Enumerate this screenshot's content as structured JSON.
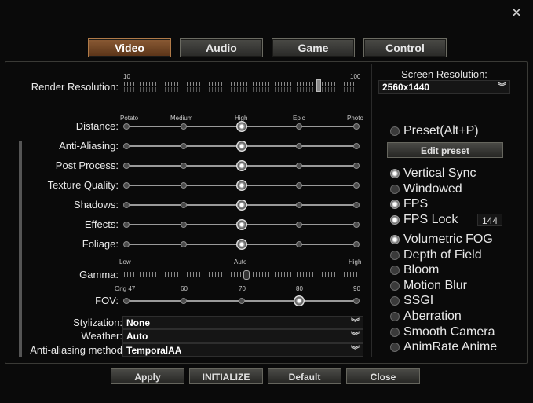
{
  "window": {
    "close_glyph": "✕"
  },
  "tabs": [
    "Video",
    "Audio",
    "Game",
    "Control"
  ],
  "render_resolution": {
    "label": "Render Resolution:",
    "min": "10",
    "max": "100",
    "value": 85
  },
  "screen_resolution": {
    "label": "Screen Resolution:",
    "value": "2560x1440"
  },
  "quality_ticks": [
    "Potato",
    "Medium",
    "High",
    "Epic",
    "Photo"
  ],
  "quality_settings": [
    {
      "label": "Distance:",
      "level": 2
    },
    {
      "label": "Anti-Aliasing:",
      "level": 2
    },
    {
      "label": "Post Process:",
      "level": 2
    },
    {
      "label": "Texture Quality:",
      "level": 2
    },
    {
      "label": "Shadows:",
      "level": 2
    },
    {
      "label": "Effects:",
      "level": 2
    },
    {
      "label": "Foliage:",
      "level": 2
    }
  ],
  "gamma": {
    "label": "Gamma:",
    "low": "Low",
    "mid": "Auto",
    "high": "High",
    "value": 0.52
  },
  "fov": {
    "label": "FOV:",
    "ticks": [
      "Orig 47",
      "60",
      "70",
      "80",
      "90"
    ],
    "value": 80
  },
  "selects": [
    {
      "label": "Stylization:",
      "value": "None"
    },
    {
      "label": "Weather:",
      "value": "Auto"
    },
    {
      "label": "Anti-aliasing method",
      "value": "TemporalAA"
    }
  ],
  "preset": {
    "label": "Preset(Alt+P)",
    "button": "Edit preset"
  },
  "options_group1": [
    {
      "label": "Vertical Sync",
      "on": true
    },
    {
      "label": "Windowed",
      "on": false
    },
    {
      "label": "FPS",
      "on": true
    },
    {
      "label": "FPS Lock",
      "on": true
    }
  ],
  "fps_lock_value": "144",
  "options_group2": [
    {
      "label": "Volumetric FOG",
      "on": true
    },
    {
      "label": "Depth of Field",
      "on": false
    },
    {
      "label": "Bloom",
      "on": false
    },
    {
      "label": "Motion Blur",
      "on": false
    },
    {
      "label": "SSGI",
      "on": false
    },
    {
      "label": "Aberration",
      "on": false
    },
    {
      "label": "Smooth Camera",
      "on": false
    },
    {
      "label": "AnimRate Anime",
      "on": false
    }
  ],
  "footer": [
    "Apply",
    "INITIALIZE",
    "Default",
    "Close"
  ],
  "icons": {
    "chevron": "chevron-double-down-icon",
    "close": "close-icon"
  }
}
